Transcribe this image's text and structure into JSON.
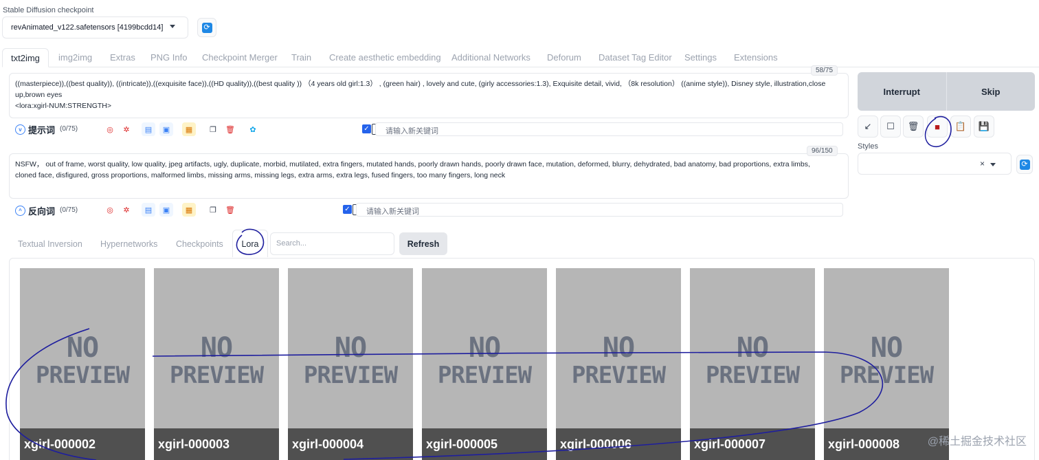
{
  "checkpoint": {
    "label": "Stable Diffusion checkpoint",
    "value": "revAnimated_v122.safetensors [4199bcdd14]"
  },
  "tabs": [
    "txt2img",
    "img2img",
    "Extras",
    "PNG Info",
    "Checkpoint Merger",
    "Train",
    "Create aesthetic embedding",
    "Additional Networks",
    "Deforum",
    "Dataset Tag Editor",
    "Settings",
    "Extensions"
  ],
  "prompt": {
    "counter": "58/75",
    "line1": "((masterpiece)),((best quality)), ((intricate)),((exquisite face)),((HD quality)),((best quality ))  （4 years old  girl:1.3）  , (green hair) , lovely and cute, (girly accessories:1.3), Exquisite detail, vivid,  （8k resolution） ((anime style)), Disney style, illustration,close",
    "line2": "up,brown eyes",
    "line3": "<lora:xgirl-NUM:STRENGTH>",
    "label": "提示词",
    "count": "(0/75)",
    "keyword_placeholder": "请输入新关键词"
  },
  "negative": {
    "counter": "96/150",
    "line1": "NSFW，  out of frame, worst quality, low quality, jpeg artifacts, ugly, duplicate, morbid, mutilated, extra fingers, mutated hands, poorly drawn hands, poorly drawn face, mutation, deformed, blurry, dehydrated, bad anatomy, bad proportions, extra limbs,",
    "line2": "cloned face, disfigured, gross proportions, malformed limbs, missing arms, missing legs, extra arms, extra legs, fused fingers, too many fingers, long neck",
    "label": "反向词",
    "count": "(0/75)",
    "keyword_placeholder": "请输入新关键词"
  },
  "actions": {
    "interrupt": "Interrupt",
    "skip": "Skip",
    "styles_label": "Styles",
    "styles_clear": "×"
  },
  "extra_networks": {
    "tabs": [
      "Textual Inversion",
      "Hypernetworks",
      "Checkpoints",
      "Lora"
    ],
    "search_placeholder": "Search...",
    "refresh": "Refresh"
  },
  "placeholder_image": {
    "line1": "NO",
    "line2": "PREVIEW"
  },
  "cards": [
    "xgirl-000002",
    "xgirl-000003",
    "xgirl-000004",
    "xgirl-000005",
    "xgirl-000006",
    "xgirl-000007",
    "xgirl-000008"
  ],
  "watermark": "@稀土掘金技术社区"
}
